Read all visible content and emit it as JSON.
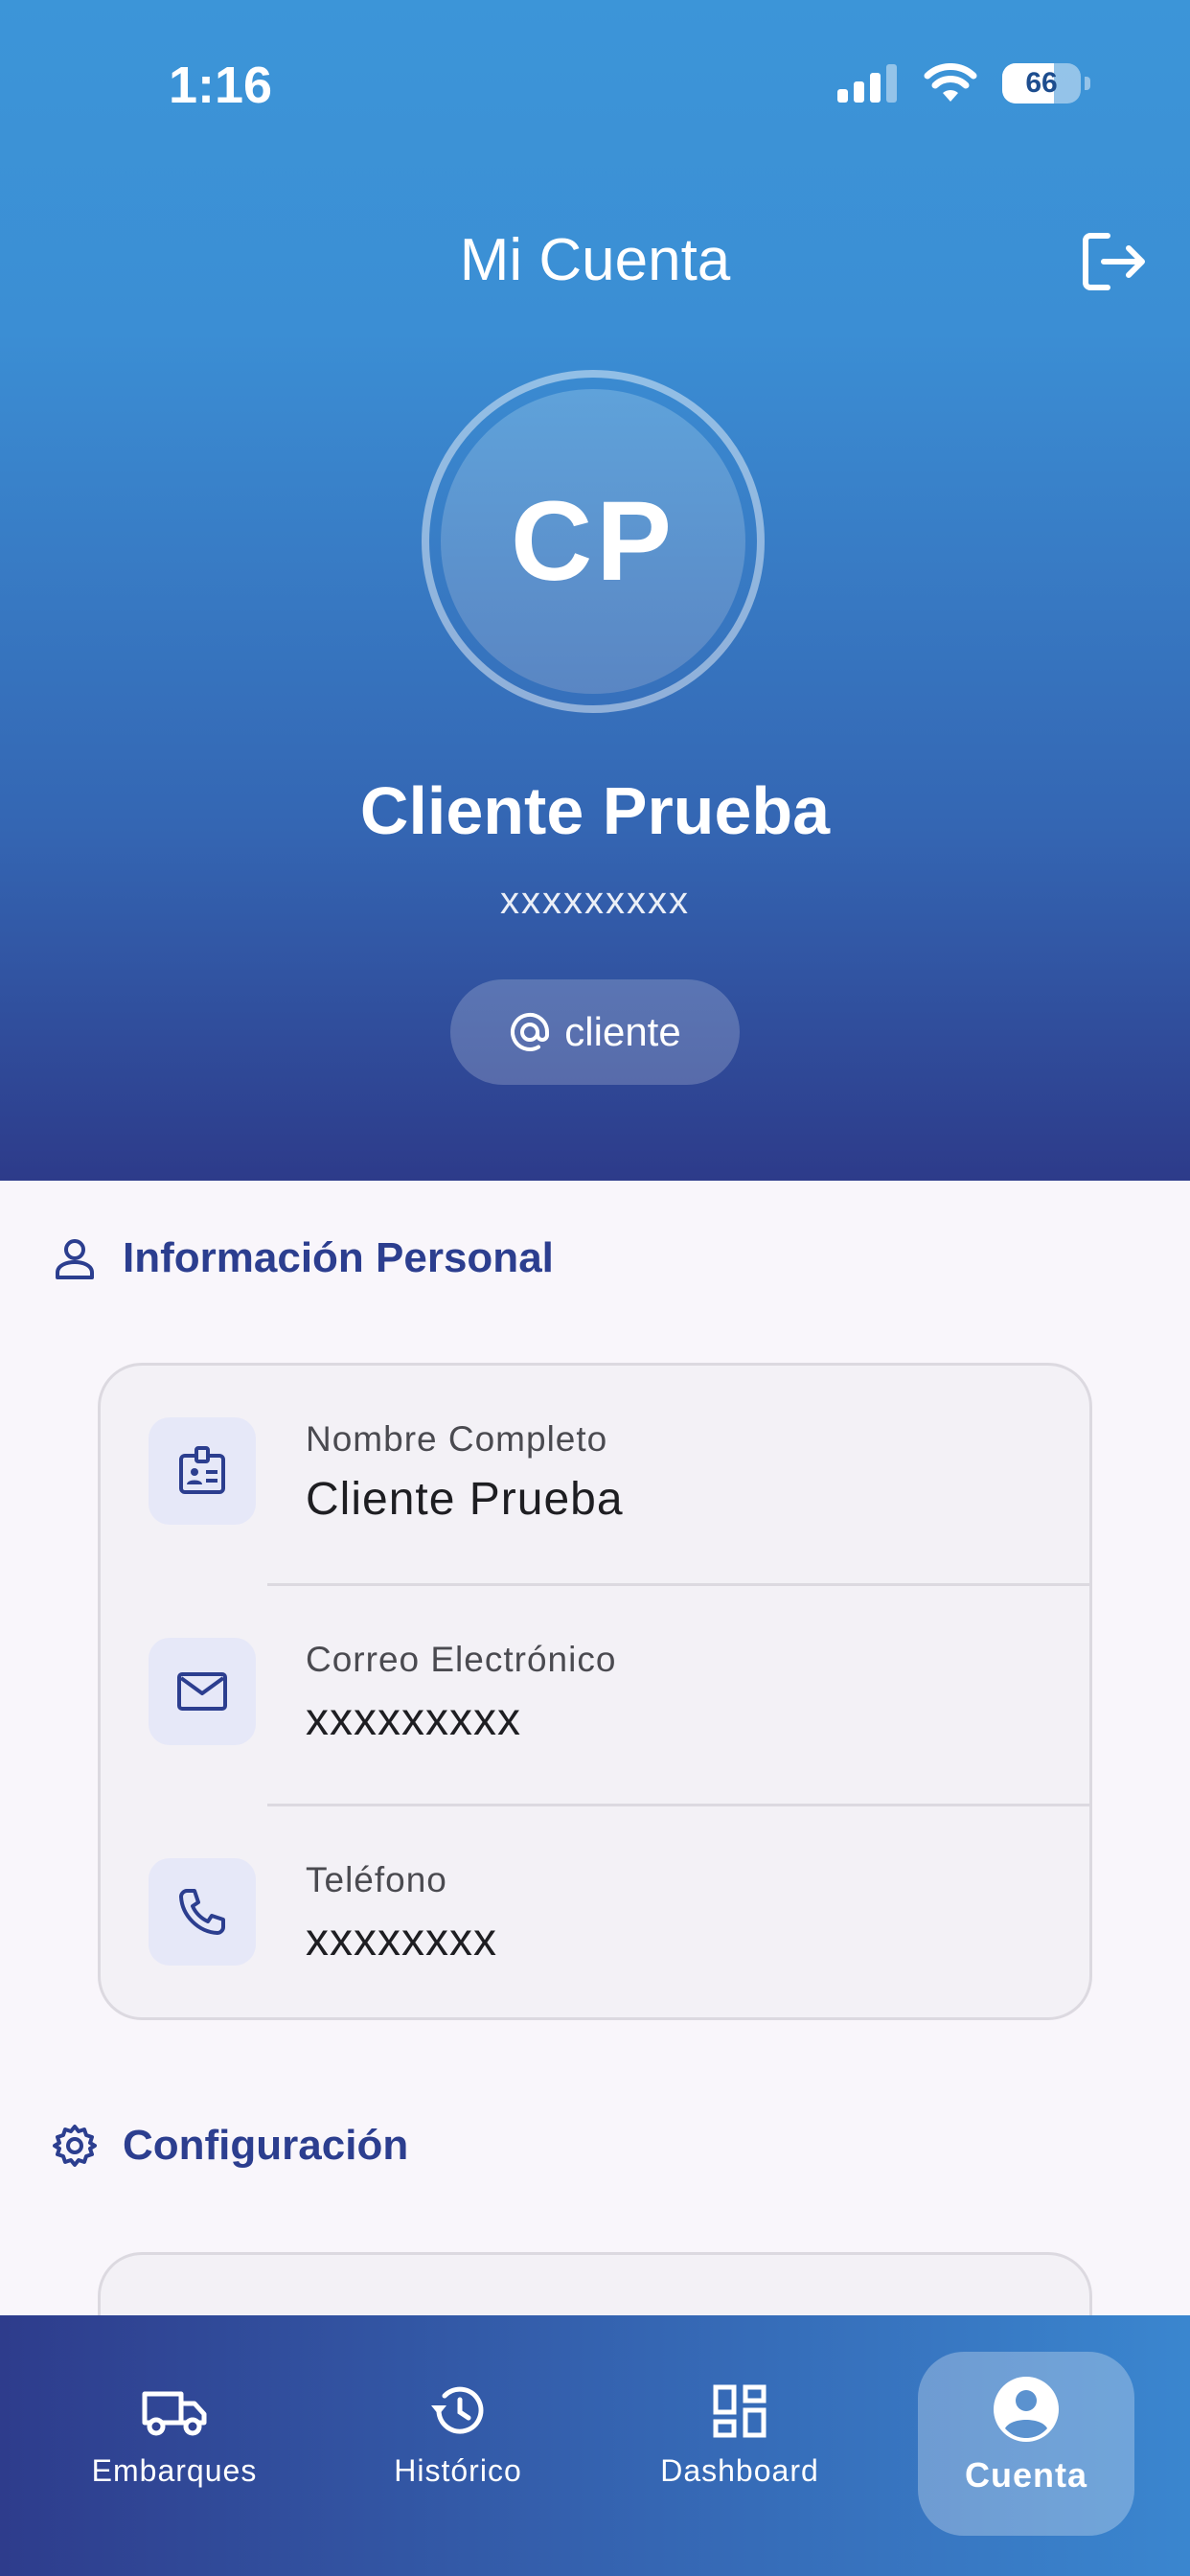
{
  "status_bar": {
    "time": "1:16",
    "battery": "66",
    "battery_level": 0.66
  },
  "header": {
    "title": "Mi Cuenta",
    "initials": "CP",
    "name": "Cliente Prueba",
    "subtitle": "xxxxxxxxx",
    "role": "cliente"
  },
  "personal_info": {
    "title": "Información Personal",
    "rows": [
      {
        "label": "Nombre Completo",
        "value": "Cliente Prueba",
        "icon": "badge-icon"
      },
      {
        "label": "Correo Electrónico",
        "value": "xxxxxxxxx",
        "icon": "mail-icon"
      },
      {
        "label": "Teléfono",
        "value": "xxxxxxxx",
        "icon": "phone-icon"
      }
    ]
  },
  "settings": {
    "title": "Configuración"
  },
  "bottom_nav": {
    "items": [
      {
        "label": "Embarques",
        "icon": "truck-icon"
      },
      {
        "label": "Histórico",
        "icon": "history-icon"
      },
      {
        "label": "Dashboard",
        "icon": "dashboard-icon"
      },
      {
        "label": "Cuenta",
        "icon": "account-icon",
        "active": true
      }
    ]
  },
  "colors": {
    "accent": "#2c3e8f",
    "header_top": "#3c95d8",
    "header_bottom": "#2d3b8a"
  }
}
